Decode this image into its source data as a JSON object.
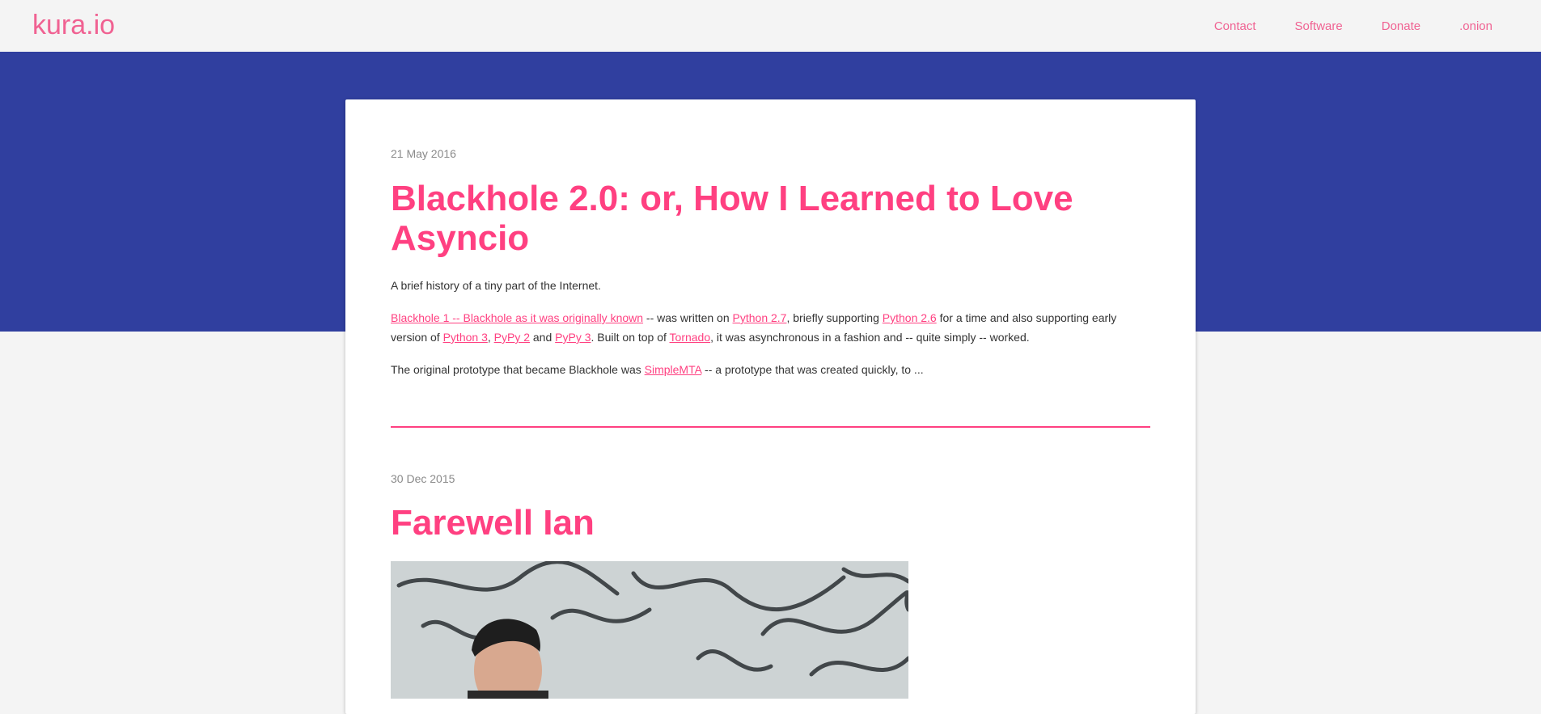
{
  "site": {
    "logo": "kura.io",
    "nav": [
      "Contact",
      "Software",
      "Donate",
      ".onion"
    ]
  },
  "colors": {
    "accent": "#ff4081",
    "logo_pink": "#f06292",
    "banner": "#303f9f",
    "background": "#f4f4f4"
  },
  "posts": [
    {
      "date": "21 May 2016",
      "title": "Blackhole 2.0: or, How I Learned to Love Asyncio",
      "summary": "A brief history of a tiny part of the Internet.",
      "p1": {
        "link_blackhole1": "Blackhole 1 -- Blackhole as it was originally known",
        "t1": " -- was written on ",
        "link_py27": "Python 2.7",
        "t2": ", briefly supporting ",
        "link_py26": "Python 2.6",
        "t3": " for a time and also supporting early version of ",
        "link_py3": "Python 3",
        "t4": ", ",
        "link_pypy2": "PyPy 2",
        "t5": " and ",
        "link_pypy3": "PyPy 3",
        "t6": ". Built on top of ",
        "link_tornado": "Tornado",
        "t7": ", it was asynchronous in a fashion and -- quite simply -- worked."
      },
      "p2": {
        "t1": "The original prototype that became Blackhole was ",
        "link_simplemta": "SimpleMTA",
        "t2": " -- a prototype that was created quickly, to ..."
      }
    },
    {
      "date": "30 Dec 2015",
      "title": "Farewell Ian",
      "image_icon": "photo-of-speaker"
    }
  ]
}
